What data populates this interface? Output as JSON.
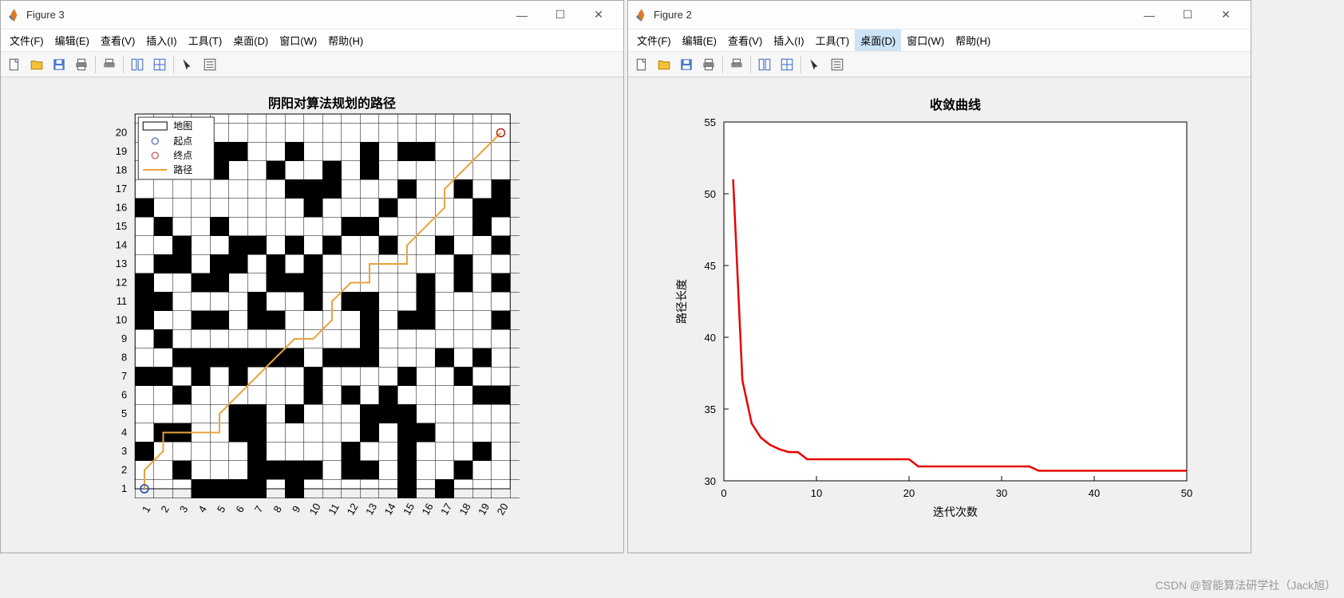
{
  "win_left": {
    "title": "Figure 3"
  },
  "win_right": {
    "title": "Figure 2"
  },
  "menus": {
    "file": "文件(F)",
    "edit": "编辑(E)",
    "view": "查看(V)",
    "insert": "插入(I)",
    "tools": "工具(T)",
    "desktop": "桌面(D)",
    "window": "窗口(W)",
    "help": "帮助(H)"
  },
  "chart_left": {
    "title": "阴阳对算法规划的路径",
    "legend": {
      "map": "地图",
      "start": "起点",
      "end": "终点",
      "path": "路径"
    },
    "x_range": [
      1,
      20
    ],
    "y_range": [
      1,
      20
    ],
    "start_point": [
      1,
      1
    ],
    "end_point": [
      20,
      20
    ],
    "path": [
      [
        1,
        1
      ],
      [
        1,
        2
      ],
      [
        2,
        3
      ],
      [
        2,
        4
      ],
      [
        3,
        4
      ],
      [
        4,
        4
      ],
      [
        5,
        4
      ],
      [
        5,
        5
      ],
      [
        6,
        6
      ],
      [
        7,
        7
      ],
      [
        8,
        8
      ],
      [
        9,
        9
      ],
      [
        10,
        9
      ],
      [
        11,
        10
      ],
      [
        11,
        11
      ],
      [
        12,
        12
      ],
      [
        13,
        12
      ],
      [
        13,
        13
      ],
      [
        14,
        13
      ],
      [
        15,
        13
      ],
      [
        15,
        14
      ],
      [
        16,
        15
      ],
      [
        17,
        16
      ],
      [
        17,
        17
      ],
      [
        18,
        18
      ],
      [
        19,
        19
      ],
      [
        20,
        20
      ]
    ],
    "obstacles": [
      [
        4,
        1
      ],
      [
        5,
        1
      ],
      [
        6,
        1
      ],
      [
        7,
        1
      ],
      [
        9,
        1
      ],
      [
        15,
        1
      ],
      [
        17,
        1
      ],
      [
        3,
        2
      ],
      [
        7,
        2
      ],
      [
        8,
        2
      ],
      [
        9,
        2
      ],
      [
        10,
        2
      ],
      [
        12,
        2
      ],
      [
        13,
        2
      ],
      [
        15,
        2
      ],
      [
        18,
        2
      ],
      [
        1,
        3
      ],
      [
        7,
        3
      ],
      [
        12,
        3
      ],
      [
        15,
        3
      ],
      [
        19,
        3
      ],
      [
        2,
        4
      ],
      [
        3,
        4
      ],
      [
        6,
        4
      ],
      [
        7,
        4
      ],
      [
        13,
        4
      ],
      [
        15,
        4
      ],
      [
        16,
        4
      ],
      [
        6,
        5
      ],
      [
        7,
        5
      ],
      [
        9,
        5
      ],
      [
        13,
        5
      ],
      [
        14,
        5
      ],
      [
        15,
        5
      ],
      [
        3,
        6
      ],
      [
        10,
        6
      ],
      [
        12,
        6
      ],
      [
        14,
        6
      ],
      [
        19,
        6
      ],
      [
        20,
        6
      ],
      [
        1,
        7
      ],
      [
        2,
        7
      ],
      [
        4,
        7
      ],
      [
        6,
        7
      ],
      [
        10,
        7
      ],
      [
        15,
        7
      ],
      [
        18,
        7
      ],
      [
        3,
        8
      ],
      [
        4,
        8
      ],
      [
        5,
        8
      ],
      [
        6,
        8
      ],
      [
        7,
        8
      ],
      [
        8,
        8
      ],
      [
        9,
        8
      ],
      [
        11,
        8
      ],
      [
        12,
        8
      ],
      [
        13,
        8
      ],
      [
        17,
        8
      ],
      [
        19,
        8
      ],
      [
        2,
        9
      ],
      [
        13,
        9
      ],
      [
        1,
        10
      ],
      [
        4,
        10
      ],
      [
        5,
        10
      ],
      [
        7,
        10
      ],
      [
        8,
        10
      ],
      [
        13,
        10
      ],
      [
        15,
        10
      ],
      [
        16,
        10
      ],
      [
        20,
        10
      ],
      [
        1,
        11
      ],
      [
        2,
        11
      ],
      [
        7,
        11
      ],
      [
        10,
        11
      ],
      [
        12,
        11
      ],
      [
        13,
        11
      ],
      [
        16,
        11
      ],
      [
        1,
        12
      ],
      [
        4,
        12
      ],
      [
        5,
        12
      ],
      [
        8,
        12
      ],
      [
        9,
        12
      ],
      [
        10,
        12
      ],
      [
        16,
        12
      ],
      [
        18,
        12
      ],
      [
        20,
        12
      ],
      [
        2,
        13
      ],
      [
        3,
        13
      ],
      [
        5,
        13
      ],
      [
        6,
        13
      ],
      [
        8,
        13
      ],
      [
        10,
        13
      ],
      [
        18,
        13
      ],
      [
        3,
        14
      ],
      [
        6,
        14
      ],
      [
        7,
        14
      ],
      [
        9,
        14
      ],
      [
        11,
        14
      ],
      [
        14,
        14
      ],
      [
        17,
        14
      ],
      [
        20,
        14
      ],
      [
        2,
        15
      ],
      [
        5,
        15
      ],
      [
        12,
        15
      ],
      [
        13,
        15
      ],
      [
        19,
        15
      ],
      [
        1,
        16
      ],
      [
        10,
        16
      ],
      [
        14,
        16
      ],
      [
        19,
        16
      ],
      [
        20,
        16
      ],
      [
        9,
        17
      ],
      [
        10,
        17
      ],
      [
        11,
        17
      ],
      [
        15,
        17
      ],
      [
        18,
        17
      ],
      [
        20,
        17
      ],
      [
        2,
        18
      ],
      [
        5,
        18
      ],
      [
        8,
        18
      ],
      [
        11,
        18
      ],
      [
        13,
        18
      ],
      [
        2,
        19
      ],
      [
        3,
        19
      ],
      [
        5,
        19
      ],
      [
        6,
        19
      ],
      [
        9,
        19
      ],
      [
        13,
        19
      ],
      [
        15,
        19
      ],
      [
        16,
        19
      ]
    ]
  },
  "chart_data": {
    "type": "line",
    "title": "收敛曲线",
    "xlabel": "迭代次数",
    "ylabel": "路径长度",
    "xlim": [
      0,
      50
    ],
    "ylim": [
      30,
      55
    ],
    "xticks": [
      0,
      10,
      20,
      30,
      40,
      50
    ],
    "yticks": [
      30,
      35,
      40,
      45,
      50,
      55
    ],
    "x": [
      1,
      2,
      3,
      4,
      5,
      6,
      7,
      8,
      9,
      10,
      15,
      20,
      21,
      25,
      30,
      33,
      34,
      40,
      45,
      50
    ],
    "y": [
      51,
      37,
      34,
      33,
      32.5,
      32.2,
      32,
      32,
      31.5,
      31.5,
      31.5,
      31.5,
      31,
      31,
      31,
      31,
      30.7,
      30.7,
      30.7,
      30.7
    ],
    "color": "#e60000"
  },
  "watermark": "CSDN @智能算法研学社（Jack旭）"
}
